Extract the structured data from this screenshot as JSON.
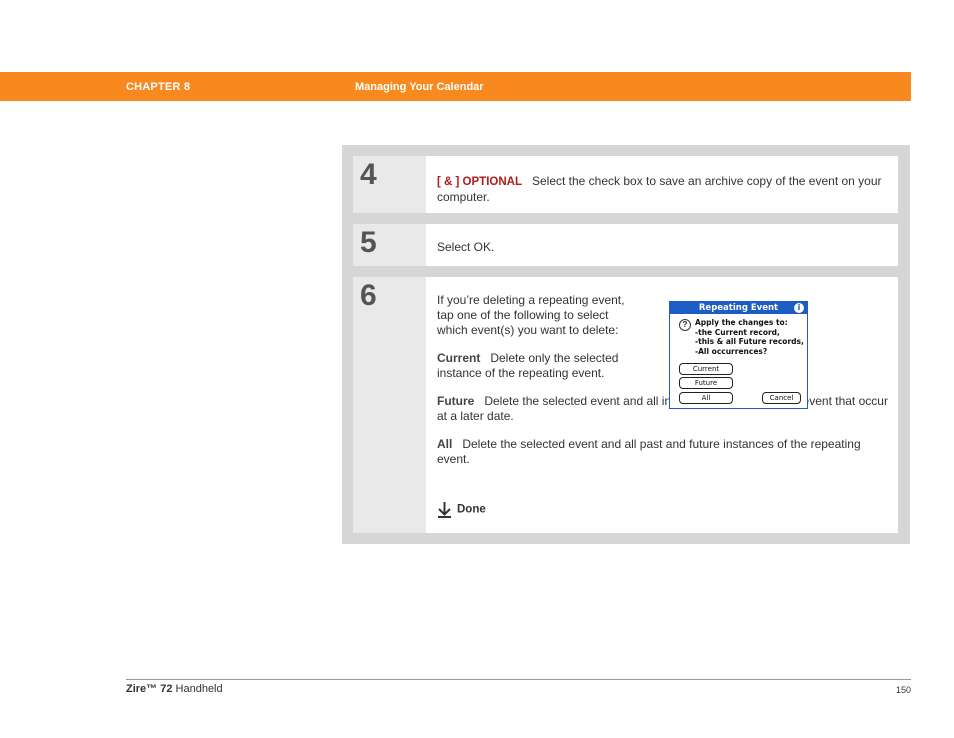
{
  "header": {
    "chapter": "CHAPTER 8",
    "title": "Managing Your Calendar"
  },
  "steps": [
    {
      "number": "4",
      "tag": "[ & ]  OPTIONAL",
      "text": "Select the check box to save an archive copy of the event on your computer."
    },
    {
      "number": "5",
      "text": "Select OK."
    },
    {
      "number": "6",
      "intro": "If you’re deleting a repeating event, tap one of the following to select which event(s) you want to delete:",
      "options": [
        {
          "term": "Current",
          "desc": "Delete only the selected instance of the repeating event."
        },
        {
          "term": "Future",
          "desc": "Delete the selected event and all instances of the repeating event that occur at a later date."
        },
        {
          "term": "All",
          "desc": "Delete the selected event and all past and future instances of the repeating event."
        }
      ],
      "done_label": "Done",
      "dialog": {
        "title": "Repeating Event",
        "info_glyph": "i",
        "question_glyph": "?",
        "message_lines": [
          "Apply the changes to:",
          "-the Current record,",
          "-this & all Future records,",
          "-All occurrences?"
        ],
        "buttons": {
          "current": "Current",
          "future": "Future",
          "all": "All",
          "cancel": "Cancel"
        }
      }
    }
  ],
  "footer": {
    "product_bold": "Zire™ 72",
    "product_rest": " Handheld",
    "page": "150"
  },
  "colors": {
    "accent": "#f7891e",
    "optional_tag": "#b01a1a",
    "palm_blue": "#1d5cc5"
  }
}
